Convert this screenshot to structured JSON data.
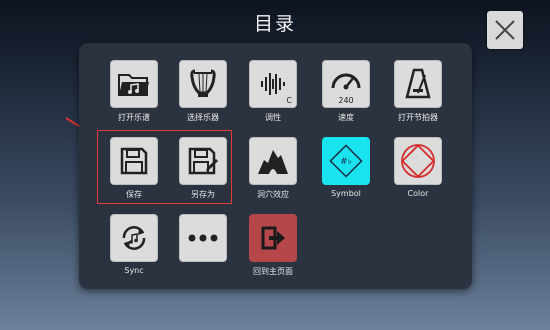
{
  "title": "目录",
  "colors": {
    "tile": "#dcdcdc",
    "symbol_tile": "#19e3ef",
    "home_tile": "#b5474a",
    "highlight": "#e23a3a"
  },
  "menu": {
    "items": [
      {
        "label": "打开乐谱",
        "icon": "folder-music-icon"
      },
      {
        "label": "选择乐器",
        "icon": "lyre-icon"
      },
      {
        "label": "调性",
        "icon": "tuning-icon",
        "sub": "C"
      },
      {
        "label": "速度",
        "icon": "speedometer-icon",
        "sub": "240"
      },
      {
        "label": "打开节拍器",
        "icon": "metronome-icon"
      },
      {
        "label": "保存",
        "icon": "save-icon"
      },
      {
        "label": "另存为",
        "icon": "save-as-icon"
      },
      {
        "label": "洞穴效应",
        "icon": "cave-icon"
      },
      {
        "label": "Symbol",
        "icon": "symbol-icon"
      },
      {
        "label": "Color",
        "icon": "color-icon"
      },
      {
        "label": "Sync",
        "icon": "sync-icon"
      },
      {
        "label": "",
        "icon": "more-icon"
      },
      {
        "label": "回到主页面",
        "icon": "exit-icon"
      }
    ]
  }
}
